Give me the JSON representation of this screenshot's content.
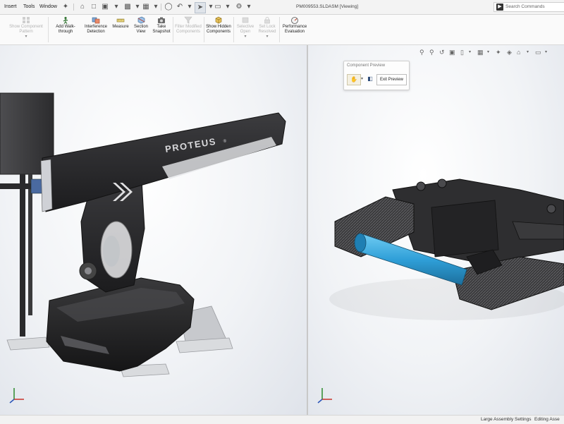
{
  "menu": {
    "items": [
      "Insert",
      "Tools",
      "Window"
    ]
  },
  "document": {
    "title": "PM009553.SLDASM [Viewing]"
  },
  "search": {
    "placeholder": "Search Commands"
  },
  "commands": [
    {
      "label": "Show Component Pattern",
      "enabled": false,
      "icon": "pattern-icon"
    },
    {
      "label": "Add Walk-through",
      "enabled": true,
      "icon": "walkthrough-icon"
    },
    {
      "label": "Interference Detection",
      "enabled": true,
      "icon": "interference-icon"
    },
    {
      "label": "Measure",
      "enabled": true,
      "icon": "measure-icon"
    },
    {
      "label": "Section View",
      "enabled": true,
      "icon": "section-view-icon"
    },
    {
      "label": "Take Snapshot",
      "enabled": true,
      "icon": "camera-icon"
    },
    {
      "label": "Filter Modified Components",
      "enabled": false,
      "icon": "filter-icon"
    },
    {
      "label": "Show Hidden Components",
      "enabled": true,
      "icon": "show-hidden-icon"
    },
    {
      "label": "Selective Open",
      "enabled": false,
      "icon": "selective-open-icon"
    },
    {
      "label": "Set Lock Resolved",
      "enabled": false,
      "icon": "lock-icon"
    },
    {
      "label": "Performance Evaluation",
      "enabled": true,
      "icon": "performance-icon"
    }
  ],
  "viewport_left": {
    "brand_text": "PROTEUS",
    "brand_mark": "®"
  },
  "component_preview": {
    "title": "Component Preview",
    "exit_label": "Exit Preview"
  },
  "status": {
    "large_assembly": "Large Assembly Settings",
    "editing": "Editing Asse"
  },
  "colors": {
    "robot_body": "#2b2b2d",
    "roller_blue": "#2f9fd8",
    "accent": "#1f5fa8"
  }
}
